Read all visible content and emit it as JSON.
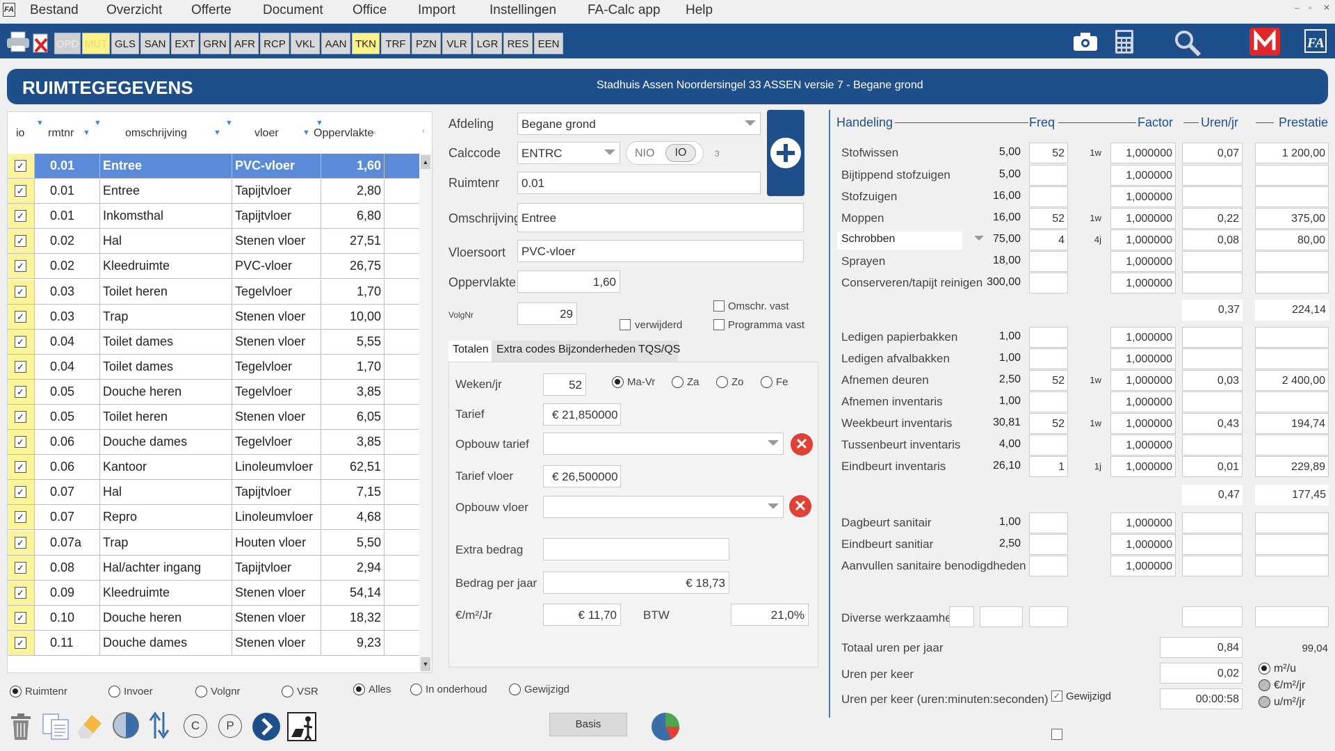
{
  "app": {
    "logo": "FA"
  },
  "menu": [
    "Bestand",
    "Overzicht",
    "Offerte",
    "Document",
    "Office",
    "Import",
    "Instellingen",
    "FA-Calc app",
    "Help"
  ],
  "toolbar": {
    "modules": [
      "OPD",
      "MUT",
      "GLS",
      "SAN",
      "EXT",
      "GRN",
      "AFR",
      "RCP",
      "VKL",
      "AAN",
      "TKN",
      "TRF",
      "PZN",
      "VLR",
      "LGR",
      "RES",
      "EEN"
    ]
  },
  "header": {
    "title": "RUIMTEGEGEVENS",
    "subtitle": "Stadhuis Assen Noordersingel 33 ASSEN versie 7 - Begane grond"
  },
  "list": {
    "columns": [
      "io",
      "rmtnr",
      "omschrijving",
      "vloer",
      "Oppervlakte"
    ],
    "rows": [
      {
        "rmtnr": "0.01",
        "omschrijving": "Entree",
        "vloer": "PVC-vloer",
        "opp": "1,60"
      },
      {
        "rmtnr": "0.01",
        "omschrijving": "Entree",
        "vloer": "Tapijtvloer",
        "opp": "2,80"
      },
      {
        "rmtnr": "0.01",
        "omschrijving": "Inkomsthal",
        "vloer": "Tapijtvloer",
        "opp": "6,80"
      },
      {
        "rmtnr": "0.02",
        "omschrijving": "Hal",
        "vloer": "Stenen vloer",
        "opp": "27,51"
      },
      {
        "rmtnr": "0.02",
        "omschrijving": "Kleedruimte",
        "vloer": "PVC-vloer",
        "opp": "26,75"
      },
      {
        "rmtnr": "0.03",
        "omschrijving": "Toilet heren",
        "vloer": "Tegelvloer",
        "opp": "1,70"
      },
      {
        "rmtnr": "0.03",
        "omschrijving": "Trap",
        "vloer": "Stenen vloer",
        "opp": "10,00"
      },
      {
        "rmtnr": "0.04",
        "omschrijving": "Toilet dames",
        "vloer": "Stenen vloer",
        "opp": "5,55"
      },
      {
        "rmtnr": "0.04",
        "omschrijving": "Toilet dames",
        "vloer": "Tegelvloer",
        "opp": "1,70"
      },
      {
        "rmtnr": "0.05",
        "omschrijving": "Douche heren",
        "vloer": "Tegelvloer",
        "opp": "3,85"
      },
      {
        "rmtnr": "0.05",
        "omschrijving": "Toilet heren",
        "vloer": "Stenen vloer",
        "opp": "6,05"
      },
      {
        "rmtnr": "0.06",
        "omschrijving": "Douche dames",
        "vloer": "Tegelvloer",
        "opp": "3,85"
      },
      {
        "rmtnr": "0.06",
        "omschrijving": "Kantoor",
        "vloer": "Linoleumvloer",
        "opp": "62,51"
      },
      {
        "rmtnr": "0.07",
        "omschrijving": "Hal",
        "vloer": "Tapijtvloer",
        "opp": "7,15"
      },
      {
        "rmtnr": "0.07",
        "omschrijving": "Repro",
        "vloer": "Linoleumvloer",
        "opp": "4,68"
      },
      {
        "rmtnr": "0.07a",
        "omschrijving": "Trap",
        "vloer": "Houten vloer",
        "opp": "5,50"
      },
      {
        "rmtnr": "0.08",
        "omschrijving": "Hal/achter ingang",
        "vloer": "Tapijtvloer",
        "opp": "2,94"
      },
      {
        "rmtnr": "0.09",
        "omschrijving": "Kleedruimte",
        "vloer": "Stenen vloer",
        "opp": "54,14"
      },
      {
        "rmtnr": "0.10",
        "omschrijving": "Douche heren",
        "vloer": "Stenen vloer",
        "opp": "18,32"
      },
      {
        "rmtnr": "0.11",
        "omschrijving": "Douche dames",
        "vloer": "Stenen vloer",
        "opp": "9,23"
      }
    ]
  },
  "form": {
    "afdeling_label": "Afdeling",
    "afdeling": "Begane grond",
    "calccode_label": "Calccode",
    "calccode": "ENTRC",
    "nio": "NIO",
    "io": "IO",
    "calc_count": "3",
    "ruimtenr_label": "Ruimtenr",
    "ruimtenr": "0.01",
    "omschrijving_label": "Omschrijving",
    "omschrijving": "Entree",
    "vloersoort_label": "Vloersoort",
    "vloersoort": "PVC-vloer",
    "oppervlakte_label": "Oppervlakte",
    "oppervlakte": "1,60",
    "volgnr_label": "VolgNr",
    "volgnr": "29",
    "omschr_vast": "Omschr. vast",
    "verwijderd": "verwijderd",
    "programma_vast": "Programma vast"
  },
  "tabs": [
    "Totalen",
    "Extra codes",
    "Bijzonderheden",
    "TQS/QS"
  ],
  "totalen": {
    "weken_label": "Weken/jr",
    "weken": "52",
    "radios": [
      "Ma-Vr",
      "Za",
      "Zo",
      "Fe"
    ],
    "tarief_label": "Tarief",
    "tarief": "€ 21,850000",
    "opbouw_tarief_label": "Opbouw tarief",
    "tarief_vloer_label": "Tarief vloer",
    "tarief_vloer": "€ 26,500000",
    "opbouw_vloer_label": "Opbouw vloer",
    "extra_label": "Extra bedrag",
    "bedrag_label": "Bedrag per jaar",
    "bedrag": "€ 18,73",
    "m2_label": "€/m²/Jr",
    "m2": "€ 11,70",
    "btw_label": "BTW",
    "btw": "21,0%"
  },
  "handeling": {
    "headers": {
      "handeling": "Handeling",
      "freq": "Freq",
      "factor": "Factor",
      "uren": "Uren/jr",
      "prestatie": "Prestatie"
    },
    "groups": [
      {
        "items": [
          {
            "name": "Stofwissen",
            "norm": "5,00",
            "freq": "52",
            "per": "1w",
            "factor": "1,000000",
            "uren": "0,07",
            "prest": "1 200,00"
          },
          {
            "name": "Bijtippend stofzuigen",
            "norm": "5,00",
            "freq": "",
            "per": "",
            "factor": "1,000000",
            "uren": "",
            "prest": ""
          },
          {
            "name": "Stofzuigen",
            "norm": "16,00",
            "freq": "",
            "per": "",
            "factor": "1,000000",
            "uren": "",
            "prest": ""
          },
          {
            "name": "Moppen",
            "norm": "16,00",
            "freq": "52",
            "per": "1w",
            "factor": "1,000000",
            "uren": "0,22",
            "prest": "375,00"
          },
          {
            "name": "Schrobben",
            "norm": "75,00",
            "freq": "4",
            "per": "4j",
            "factor": "1,000000",
            "uren": "0,08",
            "prest": "80,00"
          },
          {
            "name": "Sprayen",
            "norm": "18,00",
            "freq": "",
            "per": "",
            "factor": "1,000000",
            "uren": "",
            "prest": ""
          },
          {
            "name": "Conserveren/tapijt reinigen",
            "norm": "300,00",
            "freq": "",
            "per": "",
            "factor": "1,000000",
            "uren": "",
            "prest": ""
          }
        ],
        "sub_uren": "0,37",
        "sub_prest": "224,14"
      },
      {
        "items": [
          {
            "name": "Ledigen papierbakken",
            "norm": "1,00",
            "freq": "",
            "per": "",
            "factor": "1,000000",
            "uren": "",
            "prest": ""
          },
          {
            "name": "Ledigen afvalbakken",
            "norm": "1,00",
            "freq": "",
            "per": "",
            "factor": "1,000000",
            "uren": "",
            "prest": ""
          },
          {
            "name": "Afnemen deuren",
            "norm": "2,50",
            "freq": "52",
            "per": "1w",
            "factor": "1,000000",
            "uren": "0,03",
            "prest": "2 400,00"
          },
          {
            "name": "Afnemen inventaris",
            "norm": "1,00",
            "freq": "",
            "per": "",
            "factor": "1,000000",
            "uren": "",
            "prest": ""
          },
          {
            "name": "Weekbeurt inventaris",
            "norm": "30,81",
            "freq": "52",
            "per": "1w",
            "factor": "1,000000",
            "uren": "0,43",
            "prest": "194,74"
          },
          {
            "name": "Tussenbeurt inventaris",
            "norm": "4,00",
            "freq": "",
            "per": "",
            "factor": "1,000000",
            "uren": "",
            "prest": ""
          },
          {
            "name": "Eindbeurt inventaris",
            "norm": "26,10",
            "freq": "1",
            "per": "1j",
            "factor": "1,000000",
            "uren": "0,01",
            "prest": "229,89"
          }
        ],
        "sub_uren": "0,47",
        "sub_prest": "177,45"
      },
      {
        "items": [
          {
            "name": "Dagbeurt sanitair",
            "norm": "1,00",
            "freq": "",
            "per": "",
            "factor": "1,000000",
            "uren": "",
            "prest": ""
          },
          {
            "name": "Eindbeurt sanitiar",
            "norm": "2,50",
            "freq": "",
            "per": "",
            "factor": "1,000000",
            "uren": "",
            "prest": ""
          },
          {
            "name": "Aanvullen sanitaire benodigdheden",
            "norm": "",
            "freq": "",
            "per": "",
            "factor": "1,000000",
            "uren": "",
            "prest": ""
          }
        ]
      }
    ],
    "diverse": "Diverse werkzaamheden",
    "totaal_label": "Totaal uren per jaar",
    "totaal": "0,84",
    "totaal_prest": "99,04",
    "keer_label": "Uren per keer",
    "keer": "0,02",
    "keer_hms_label": "Uren per keer (uren:minuten:seconden)",
    "keer_hms": "00:00:58",
    "gewijzigd": "Gewijzigd",
    "units": [
      "m²/u",
      "€/m²/jr",
      "u/m²/jr"
    ]
  },
  "bottom": {
    "radios": [
      "Ruimtenr",
      "Invoer",
      "Volgnr",
      "VSR"
    ],
    "filters": [
      "Alles",
      "In onderhoud",
      "Gewijzigd"
    ],
    "basis": "Basis",
    "c": "C",
    "p": "P"
  },
  "colors": {
    "primary": "#1e4f8a",
    "selected": "#5b8ad8",
    "highlight": "#fbf28a"
  }
}
